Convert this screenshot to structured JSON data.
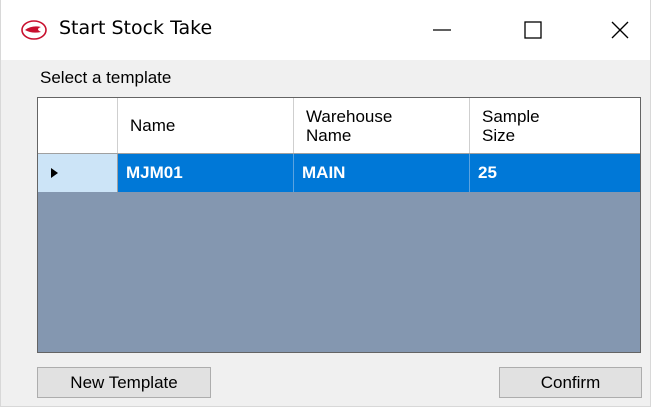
{
  "window": {
    "title": "Start Stock Take",
    "icons": {
      "app": "app-logo-icon",
      "minimize": "minimize-icon",
      "maximize": "maximize-icon",
      "close": "close-icon"
    }
  },
  "form": {
    "select_label": "Select a template"
  },
  "grid": {
    "columns": [
      {
        "label": "Name"
      },
      {
        "label": "Warehouse\nName"
      },
      {
        "label": "Sample\nSize"
      }
    ],
    "rows": [
      {
        "name": "MJM01",
        "warehouse_name": "MAIN",
        "sample_size": "25",
        "selected": true
      }
    ],
    "colors": {
      "background": "#8497b0",
      "selected_row": "#0078d7",
      "row_header_selected": "#cce4f7"
    }
  },
  "buttons": {
    "new_template": "New Template",
    "confirm": "Confirm"
  }
}
